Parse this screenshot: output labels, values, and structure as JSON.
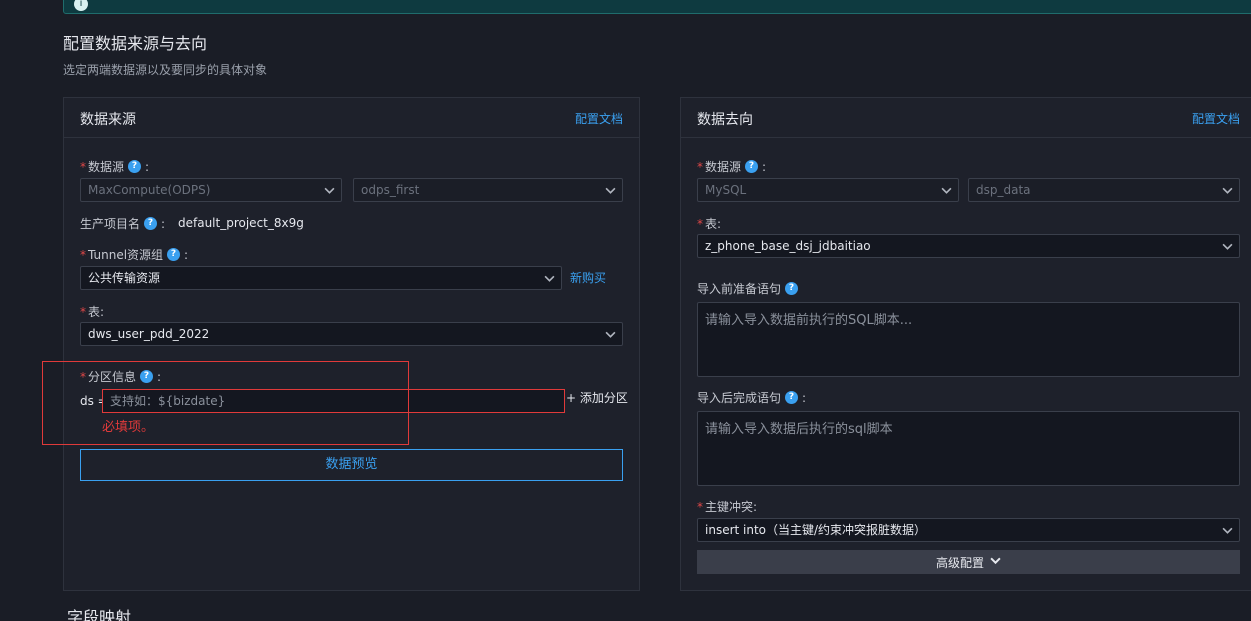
{
  "section": {
    "title": "配置数据来源与去向",
    "subtitle": "选定两端数据源以及要同步的具体对象"
  },
  "source": {
    "title": "数据来源",
    "doc_link": "配置文档",
    "datasource_label": "数据源",
    "datasource_type": "MaxCompute(ODPS)",
    "datasource_name": "odps_first",
    "project_label": "生产项目名",
    "project_value": "default_project_8x9g",
    "tunnel_label": "Tunnel资源组",
    "tunnel_value": "公共传输资源",
    "tunnel_buy": "新购买",
    "table_label": "表:",
    "table_value": "dws_user_pdd_2022",
    "partition_label": "分区信息",
    "partition_key": "ds =",
    "partition_placeholder": "支持如：${bizdate}",
    "add_partition": "+ 添加分区",
    "required_error": "必填项。",
    "preview_button": "数据预览"
  },
  "target": {
    "title": "数据去向",
    "doc_link": "配置文档",
    "datasource_label": "数据源",
    "datasource_type": "MySQL",
    "datasource_name": "dsp_data",
    "table_label": "表:",
    "table_value": "z_phone_base_dsj_jdbaitiao",
    "pre_sql_label": "导入前准备语句",
    "pre_sql_placeholder": "请输入导入数据前执行的SQL脚本...",
    "post_sql_label": "导入后完成语句",
    "post_sql_placeholder": "请输入导入数据后执行的sql脚本",
    "conflict_label": "主键冲突:",
    "conflict_value": "insert into（当主键/约束冲突报脏数据）",
    "advanced_button": "高级配置"
  },
  "field_mapping_title": "字段映射"
}
